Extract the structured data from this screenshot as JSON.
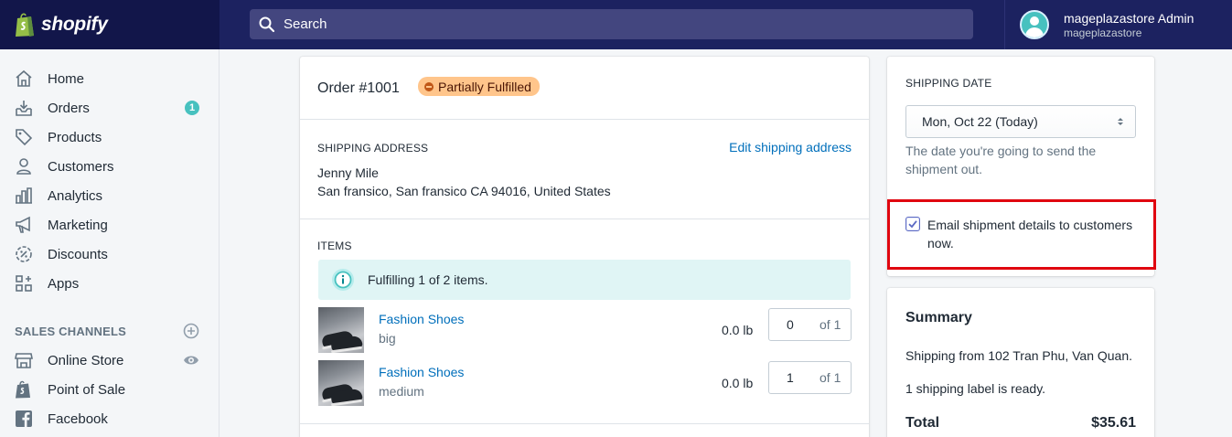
{
  "brand": {
    "name": "shopify"
  },
  "search": {
    "placeholder": "Search"
  },
  "user": {
    "name": "mageplazastore Admin",
    "store": "mageplazastore"
  },
  "sidebar": {
    "items": [
      {
        "label": "Home",
        "icon": "home-icon"
      },
      {
        "label": "Orders",
        "icon": "orders-icon",
        "badge": "1"
      },
      {
        "label": "Products",
        "icon": "tag-icon"
      },
      {
        "label": "Customers",
        "icon": "person-icon"
      },
      {
        "label": "Analytics",
        "icon": "bar-chart-icon"
      },
      {
        "label": "Marketing",
        "icon": "megaphone-icon"
      },
      {
        "label": "Discounts",
        "icon": "discount-icon"
      },
      {
        "label": "Apps",
        "icon": "apps-icon"
      }
    ],
    "channels_title": "SALES CHANNELS",
    "channels": [
      {
        "label": "Online Store",
        "icon": "store-icon"
      },
      {
        "label": "Point of Sale",
        "icon": "shopify-bag-icon"
      },
      {
        "label": "Facebook",
        "icon": "facebook-icon"
      }
    ]
  },
  "order": {
    "title": "Order #1001",
    "status": "Partially Fulfilled",
    "shipping_label": "SHIPPING ADDRESS",
    "edit_link": "Edit shipping address",
    "address_name": "Jenny Mile",
    "address_line": "San fransico, San fransico CA 94016, United States",
    "items_label": "ITEMS",
    "banner": "Fulfilling 1 of 2 items.",
    "items": [
      {
        "name": "Fashion Shoes",
        "variant": "big",
        "weight": "0.0 lb",
        "qty": "0",
        "of": "of 1"
      },
      {
        "name": "Fashion Shoes",
        "variant": "medium",
        "weight": "0.0 lb",
        "qty": "1",
        "of": "of 1"
      }
    ]
  },
  "shipping_date": {
    "label": "SHIPPING DATE",
    "selected": "Mon, Oct 22 (Today)",
    "help": "The date you're going to send the shipment out.",
    "email_checkbox": "Email shipment details to customers now.",
    "email_checked": true
  },
  "summary": {
    "title": "Summary",
    "shipping_from": "Shipping from 102 Tran Phu, Van Quan.",
    "labels_ready": "1 shipping label is ready.",
    "total_label": "Total",
    "total_value": "$35.61"
  },
  "colors": {
    "topbar": "#1c2260",
    "accent": "#47c1bf",
    "link": "#006fbb",
    "status_badge": "#ffc58b",
    "highlight": "#e0060f"
  }
}
